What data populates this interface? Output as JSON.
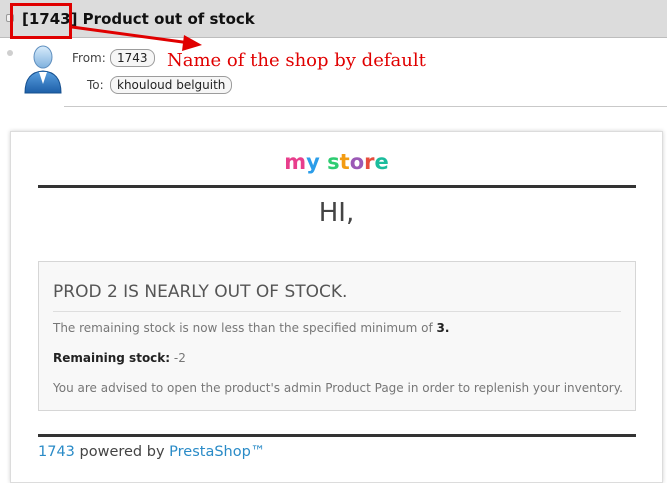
{
  "header": {
    "subject": "[1743] Product out of stock"
  },
  "annotation": {
    "text": "Name of the shop by default",
    "color": "#e00000"
  },
  "sender": {
    "from_label": "From:",
    "from_value": "1743",
    "to_label": "To:",
    "to_value": "khouloud belguith"
  },
  "email": {
    "logo_parts": [
      "m",
      "y",
      " ",
      "s",
      "t",
      "o",
      "r",
      "e"
    ],
    "logo_colors": [
      "#e83e8c",
      "#2b9de9",
      "#ffffff",
      "#2ecc71",
      "#f39c12",
      "#9b59b6",
      "#e74c3c",
      "#1abc9c"
    ],
    "greeting": "HI,",
    "alert_title": "PROD 2 IS NEARLY OUT OF STOCK.",
    "remaining_text": "The remaining stock is now less than the specified minimum of",
    "minimum": "3.",
    "remaining_label": "Remaining stock:",
    "remaining_value": "-2",
    "advice": "You are advised to open the product's admin Product Page in order to replenish your inventory.",
    "footer_shop": "1743",
    "footer_powered": "powered by",
    "footer_brand": "PrestaShop™",
    "link_color": "#2a8bc7"
  }
}
